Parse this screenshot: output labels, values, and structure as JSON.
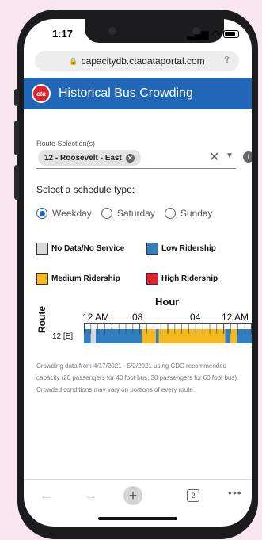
{
  "status": {
    "time": "1:17"
  },
  "browser": {
    "url": "capacitydb.ctadataportal.com",
    "tab_count": "2"
  },
  "header": {
    "logo_text": "cta",
    "title": "Historical Bus Crowding"
  },
  "route": {
    "label": "Route Selection(s)",
    "selected": "12 - Roosevelt - East"
  },
  "schedule": {
    "label": "Select a schedule type:",
    "options": [
      "Weekday",
      "Saturday",
      "Sunday"
    ],
    "selected": "Weekday"
  },
  "legend": [
    {
      "label": "No Data/No Service",
      "color": "#d9d9d9"
    },
    {
      "label": "Low Ridership",
      "color": "#2f7ec1"
    },
    {
      "label": "Medium Ridership",
      "color": "#f5b81e"
    },
    {
      "label": "High Ridership",
      "color": "#e3232c"
    }
  ],
  "chart_data": {
    "type": "heatmap",
    "title": "Hour",
    "ylabel": "Route",
    "x_ticks": [
      "12 AM",
      "08",
      "04",
      "12 AM"
    ],
    "rows": [
      "12 [E]"
    ],
    "x_range": [
      0,
      24
    ],
    "segments": [
      {
        "start": 0,
        "end": 1,
        "level": "low"
      },
      {
        "start": 1,
        "end": 1.7,
        "level": "none"
      },
      {
        "start": 1.7,
        "end": 8.3,
        "level": "low"
      },
      {
        "start": 8.3,
        "end": 10.3,
        "level": "medium"
      },
      {
        "start": 10.3,
        "end": 10.7,
        "level": "low"
      },
      {
        "start": 10.7,
        "end": 20.2,
        "level": "medium"
      },
      {
        "start": 20.2,
        "end": 20.9,
        "level": "low"
      },
      {
        "start": 20.9,
        "end": 21.9,
        "level": "medium"
      },
      {
        "start": 21.9,
        "end": 24,
        "level": "low"
      }
    ]
  },
  "note": "Crowding data from 4/17/2021 - 5/2/2021 using CDC recommended capacity (20 passengers for 40 foot bus, 30 passengers for 60 foot bus). Crowded conditions may vary on portions of every route."
}
